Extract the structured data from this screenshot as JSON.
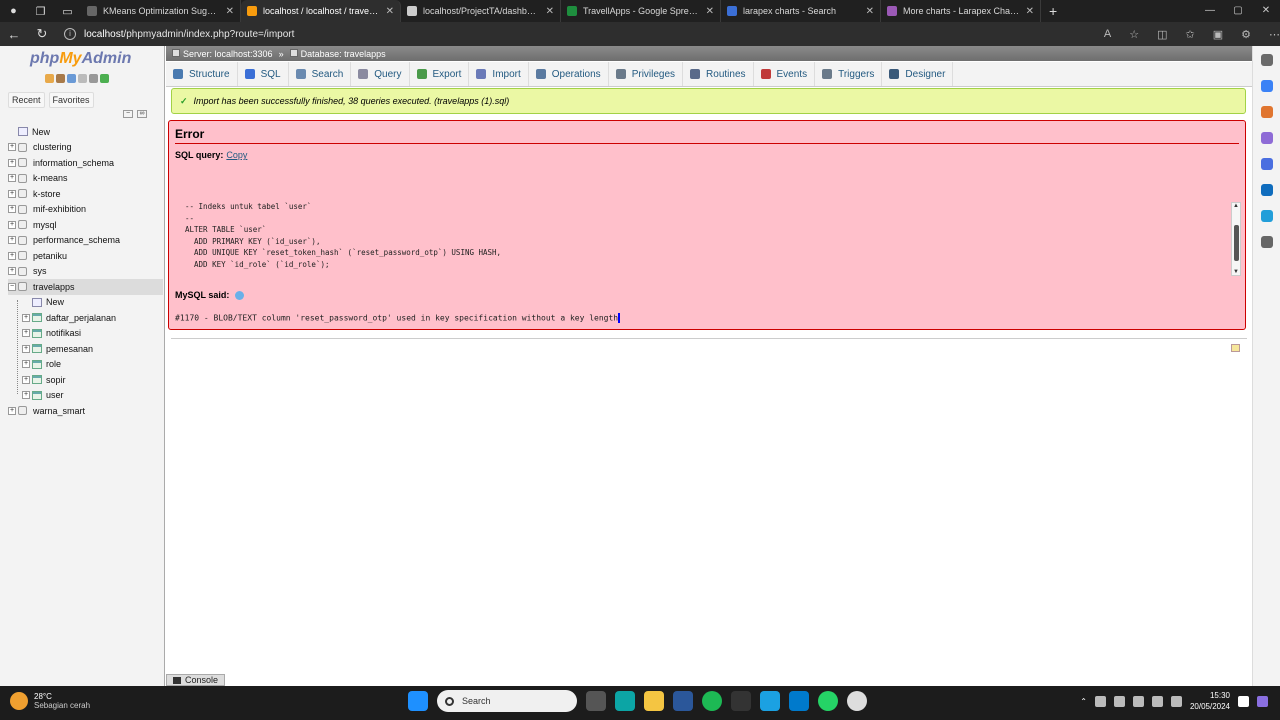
{
  "browser": {
    "tabs": [
      {
        "title": "KMeans Optimization Suggestio",
        "favicon_color": "#666666",
        "active": false
      },
      {
        "title": "localhost / localhost / travelapp",
        "favicon_color": "#f89c0e",
        "active": true
      },
      {
        "title": "localhost/ProjectTA/dashboard.p",
        "favicon_color": "#cccccc",
        "active": false
      },
      {
        "title": "TravellApps - Google Spreadshe",
        "favicon_color": "#1e8e3e",
        "active": false
      },
      {
        "title": "larapex charts - Search",
        "favicon_color": "#3b6fd6",
        "active": false
      },
      {
        "title": "More charts - Larapex Charts",
        "favicon_color": "#9b59b6",
        "active": false
      }
    ],
    "url_host": "localhost",
    "url_path": "/phpmyadmin/index.php?route=/import"
  },
  "pma": {
    "logo_php": "php",
    "logo_my": "My",
    "logo_admin": "Admin",
    "nav_tabs": [
      "Recent",
      "Favorites"
    ],
    "tree": [
      {
        "label": "New",
        "type": "new",
        "level": 0
      },
      {
        "label": "clustering",
        "type": "db",
        "level": 0
      },
      {
        "label": "information_schema",
        "type": "db",
        "level": 0
      },
      {
        "label": "k-means",
        "type": "db",
        "level": 0
      },
      {
        "label": "k-store",
        "type": "db",
        "level": 0
      },
      {
        "label": "mif-exhibition",
        "type": "db",
        "level": 0
      },
      {
        "label": "mysql",
        "type": "db",
        "level": 0
      },
      {
        "label": "performance_schema",
        "type": "db",
        "level": 0
      },
      {
        "label": "petaniku",
        "type": "db",
        "level": 0
      },
      {
        "label": "sys",
        "type": "db",
        "level": 0
      },
      {
        "label": "travelapps",
        "type": "db",
        "level": 0,
        "expanded": true
      },
      {
        "label": "New",
        "type": "new",
        "level": 1
      },
      {
        "label": "daftar_perjalanan",
        "type": "table",
        "level": 1
      },
      {
        "label": "notifikasi",
        "type": "table",
        "level": 1
      },
      {
        "label": "pemesanan",
        "type": "table",
        "level": 1
      },
      {
        "label": "role",
        "type": "table",
        "level": 1
      },
      {
        "label": "sopir",
        "type": "table",
        "level": 1
      },
      {
        "label": "user",
        "type": "table",
        "level": 1
      },
      {
        "label": "warna_smart",
        "type": "db",
        "level": 0
      }
    ],
    "breadcrumb": {
      "server": "Server: localhost:3306",
      "sep": "»",
      "database": "Database: travelapps"
    },
    "menu": [
      "Structure",
      "SQL",
      "Search",
      "Query",
      "Export",
      "Import",
      "Operations",
      "Privileges",
      "Routines",
      "Events",
      "Triggers",
      "Designer"
    ],
    "success_message": "Import has been successfully finished, 38 queries executed. (travelapps (1).sql)",
    "error": {
      "title": "Error",
      "sql_query_label": "SQL query:",
      "copy_label": "Copy",
      "code_lines": [
        "-- Indeks untuk tabel `user`",
        "--",
        "ALTER TABLE `user`",
        "  ADD PRIMARY KEY (`id_user`),",
        "  ADD UNIQUE KEY `reset_token_hash` (`reset_password_otp`) USING HASH,",
        "  ADD KEY `id_role` (`id_role`);"
      ],
      "mysql_said_label": "MySQL said:",
      "message": "#1170 - BLOB/TEXT column 'reset_password_otp' used in key specification without a key length"
    },
    "console_label": "Console"
  },
  "taskbar": {
    "temperature": "28°C",
    "weather": "Sebagian cerah",
    "search_placeholder": "Search",
    "time": "15:30",
    "date": "20/05/2024"
  }
}
